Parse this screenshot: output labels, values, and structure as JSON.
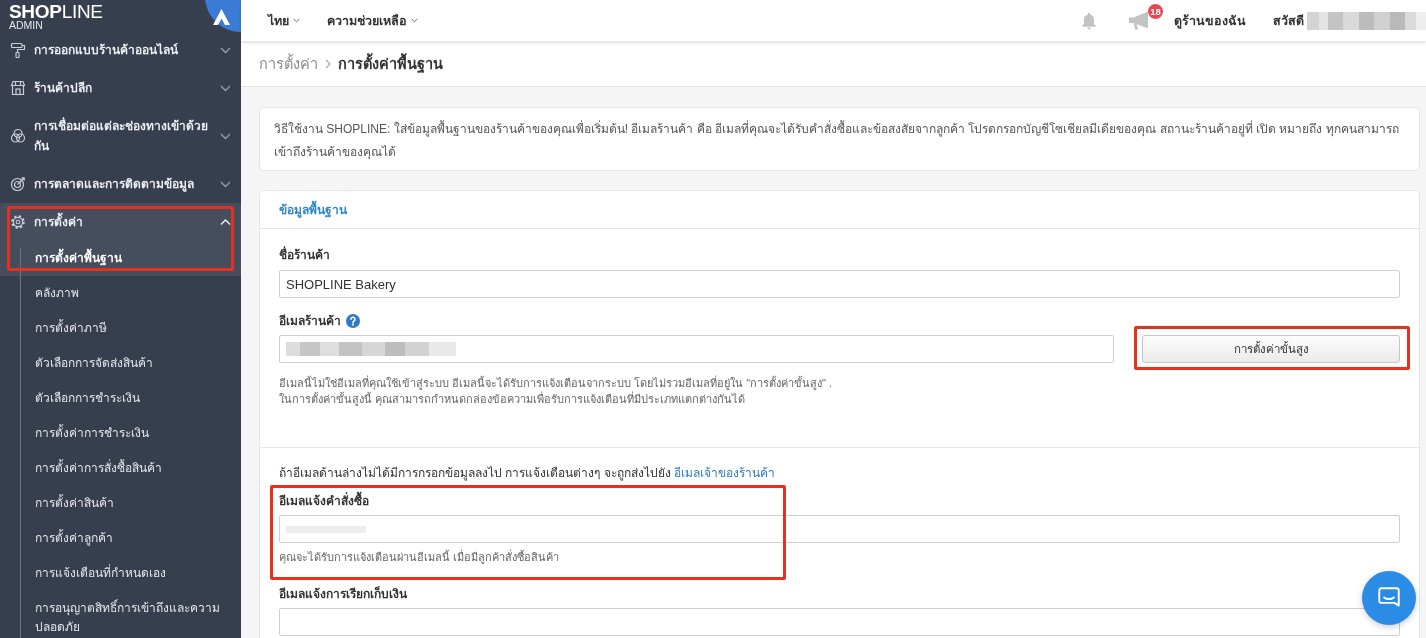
{
  "sidebar": {
    "logo": {
      "wordmark": "**SHOP**LINE",
      "subtitle": "ADMIN"
    },
    "items": [
      {
        "label": "การออกแบบร้านค้าออนไลน์",
        "expanded": false
      },
      {
        "label": "ร้านค้าปลีก",
        "expanded": false
      },
      {
        "label": "การเชื่อมต่อแต่ละช่องทางเข้าด้วยกัน",
        "expanded": false
      },
      {
        "label": "การตลาดและการติดตามข้อมูล",
        "expanded": false
      },
      {
        "label": "การตั้งค่า",
        "expanded": true,
        "highlighted": true,
        "children": [
          {
            "label": "การตั้งค่าพื้นฐาน",
            "selected": true
          },
          {
            "label": "คลังภาพ",
            "selected": false
          },
          {
            "label": "การตั้งค่าภาษี",
            "selected": false
          },
          {
            "label": "ตัวเลือกการจัดส่งสินค้า",
            "selected": false
          },
          {
            "label": "ตัวเลือกการชำระเงิน",
            "selected": false
          },
          {
            "label": "การตั้งค่าการชำระเงิน",
            "selected": false
          },
          {
            "label": "การตั้งค่าการสั่งซื้อสินค้า",
            "selected": false
          },
          {
            "label": "การตั้งค่าสินค้า",
            "selected": false
          },
          {
            "label": "การตั้งค่าลูกค้า",
            "selected": false
          },
          {
            "label": "การแจ้งเตือนที่กำหนดเอง",
            "selected": false
          },
          {
            "label": "การอนุญาตสิทธิ์การเข้าถึงและความปลอดภัย",
            "selected": false
          }
        ]
      }
    ]
  },
  "top_bar": {
    "menus": [
      {
        "label": "ไทย"
      },
      {
        "label": "ความช่วยเหลือ"
      }
    ],
    "announcement_count": "18",
    "view_store_link": "ดูร้านของฉัน",
    "greeting": "สวัสดี",
    "user_name_hidden": true
  },
  "breadcrumb": [
    {
      "label": "การตั้งค่า",
      "current": false
    },
    {
      "label": "การตั้งค่าพื้นฐาน",
      "current": true
    }
  ],
  "intro_text": "วิธีใช้งาน SHOPLINE: ใส่ข้อมูลพื้นฐานของร้านค้าของคุณเพื่อเริ่มต้น! อีเมลร้านค้า คือ อีเมลที่คุณจะได้รับคำสั่งซื้อและข้อสงสัยจากลูกค้า โปรดกรอกบัญชีโซเชียลมีเดียของคุณ สถานะร้านค้าอยู่ที่ เปิด หมายถึง ทุกคนสามารถเข้าถึงร้านค้าของคุณได้",
  "basic_info": {
    "title": "ข้อมูลพื้นฐาน",
    "store_name": {
      "label": "ชื่อร้านค้า",
      "value": "SHOPLINE Bakery"
    },
    "store_email": {
      "label": "อีเมลร้านค้า",
      "value_hidden": true,
      "advanced_button": {
        "label": "การตั้งค่าขั้นสูง",
        "highlighted": true
      },
      "help": [
        "อีเมลนี้ไม่ใช่อีเมลที่คุณใช้เข้าสู่ระบบ อีเมลนี้จะได้รับการแจ้งเตือนจากระบบ โดยไม่รวมอีเมลที่อยู่ใน \"การตั้งค่าขั้นสูง\" .",
        "ในการตั้งค่าขั้นสูงนี้ คุณสามารถกำหนดกล่องข้อความเพื่อรับการแจ้งเตือนที่มีประเภทแตกต่างกันได้"
      ]
    },
    "fallback_note": {
      "text": "ถ้าอีเมลด้านล่างไม่ได้มีการกรอกข้อมูลลงไป การแจ้งเตือนต่างๆ จะถูกส่งไปยัง",
      "link": "อีเมลเจ้าของร้านค้า"
    },
    "notification_emails": [
      {
        "label": "อีเมลแจ้งคำสั่งซื้อ",
        "placeholder_hidden": true,
        "help": "คุณจะได้รับการแจ้งเตือนผ่านอีเมลนี้ เมื่อมีลูกค้าสั่งซื้อสินค้า",
        "highlighted": true
      },
      {
        "label": "อีเมลแจ้งการเรียกเก็บเงิน",
        "placeholder_hidden": false,
        "highlighted": false
      }
    ]
  }
}
